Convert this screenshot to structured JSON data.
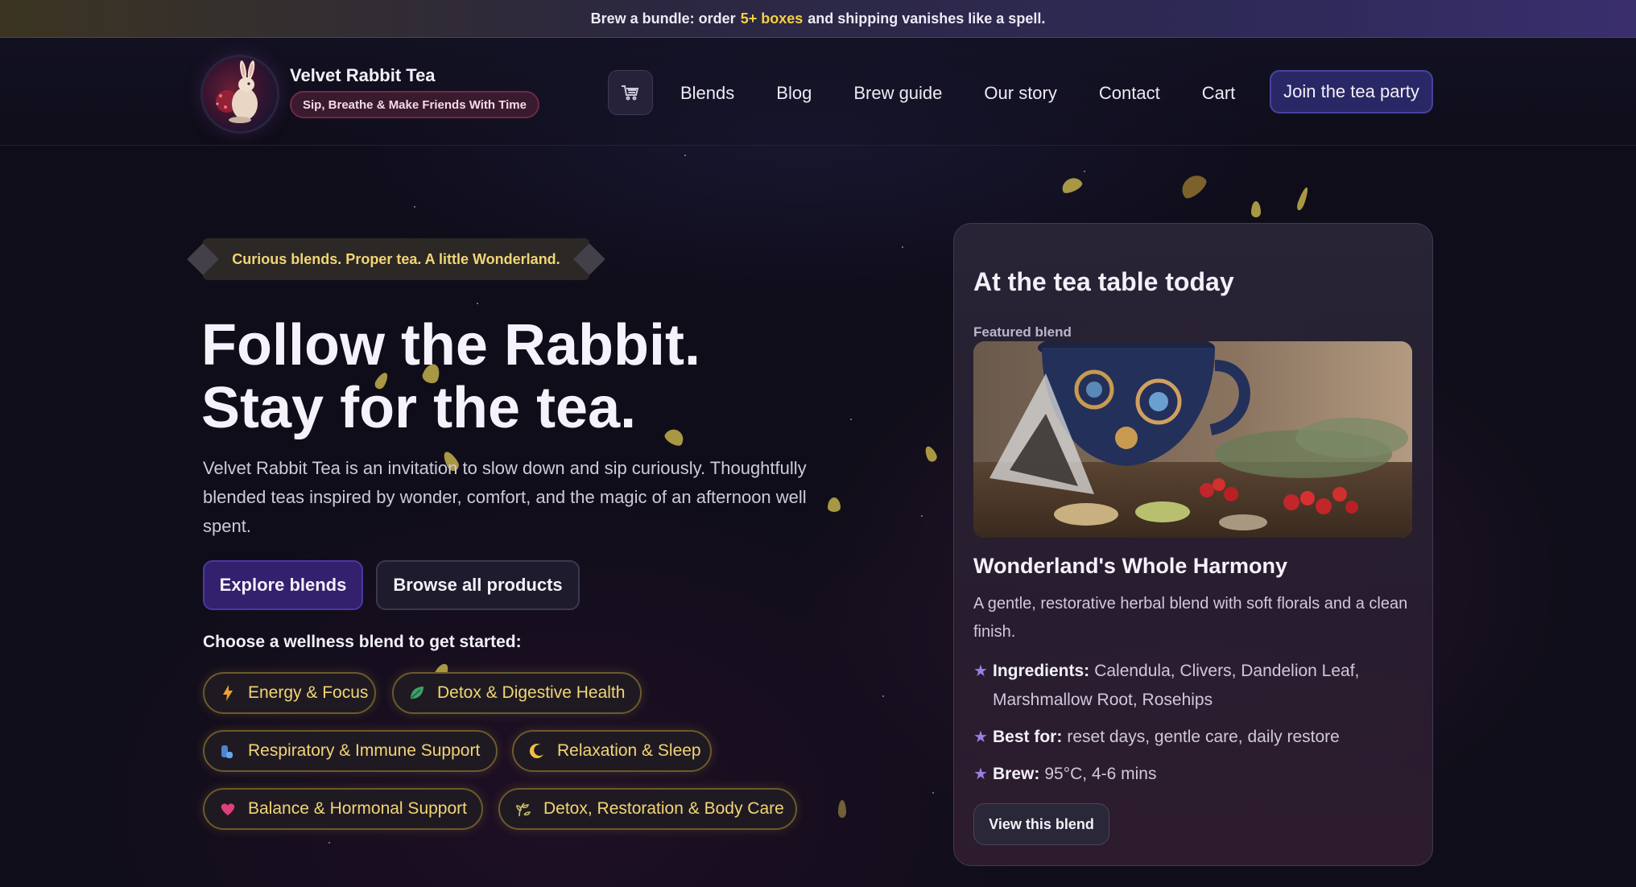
{
  "promo": {
    "before": "Brew a bundle: order",
    "highlight": "5+ boxes",
    "after": "and shipping vanishes like a spell."
  },
  "header": {
    "brand_name": "Velvet Rabbit Tea",
    "tagline": "Sip, Breathe & Make Friends With Time",
    "logo_icon": "rabbit-teapot-logo",
    "cart_icon": "cart-icon",
    "nav": [
      "Blends",
      "Blog",
      "Brew guide",
      "Our story",
      "Contact",
      "Cart"
    ],
    "cta": "Join the tea party"
  },
  "hero": {
    "tag": "Curious blends. Proper tea. A little Wonderland.",
    "title_line1": "Follow the Rabbit.",
    "title_line2": "Stay for the tea.",
    "description": "Velvet Rabbit Tea is an invitation to slow down and sip curiously. Thoughtfully blended teas inspired by wonder, comfort, and the magic of an afternoon well spent.",
    "primary_button": "Explore blends",
    "secondary_button": "Browse all products",
    "choose_label": "Choose a wellness blend to get started:",
    "chips": [
      {
        "label": "Energy & Focus",
        "icon": "lightning-icon"
      },
      {
        "label": "Detox & Digestive Health",
        "icon": "leaf-icon"
      },
      {
        "label": "Respiratory & Immune Support",
        "icon": "lungs-icon"
      },
      {
        "label": "Relaxation & Sleep",
        "icon": "moon-icon"
      },
      {
        "label": "Balance & Hormonal Support",
        "icon": "heart-icon"
      },
      {
        "label": "Detox, Restoration & Body Care",
        "icon": "herb-icon"
      }
    ]
  },
  "featured": {
    "heading": "At the tea table today",
    "kicker": "Featured blend",
    "image": "teacup-and-herbs-photo",
    "name": "Wonderland's Whole Harmony",
    "description": "A gentle, restorative herbal blend with soft florals and a clean finish.",
    "facts": [
      {
        "label": "Ingredients:",
        "value": "Calendula, Clivers, Dandelion Leaf, Marshmallow Root, Rosehips"
      },
      {
        "label": "Best for:",
        "value": "reset days, gentle care, daily restore"
      },
      {
        "label": "Brew:",
        "value": "95°C, 4-6 mins"
      }
    ],
    "button": "View this blend"
  },
  "colors": {
    "background": "#0f0d19",
    "accent_gold": "#f2d575",
    "accent_purple": "#4a38a0",
    "highlight_yellow": "#f5d040"
  }
}
